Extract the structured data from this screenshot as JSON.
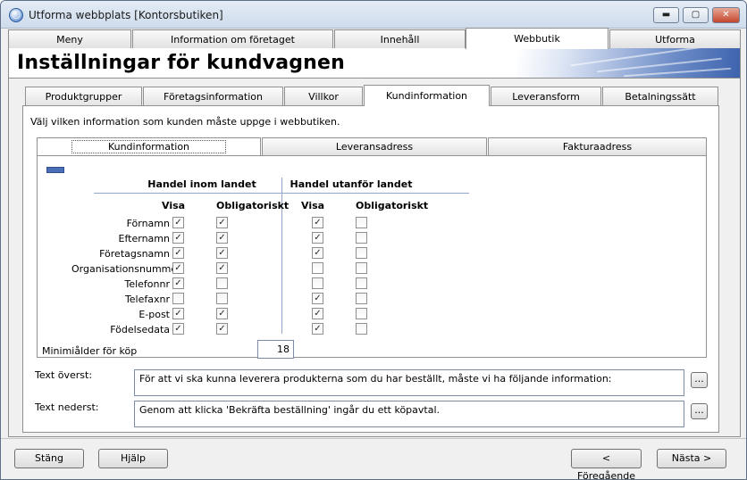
{
  "window": {
    "title": "Utforma webbplats [Kontorsbutiken]"
  },
  "main_tabs": [
    {
      "label": "Meny"
    },
    {
      "label": "Information om företaget"
    },
    {
      "label": "Innehåll"
    },
    {
      "label": "Webbutik"
    },
    {
      "label": "Utforma"
    }
  ],
  "main_tabs_active": "Webbutik",
  "page_title": "Inställningar för kundvagnen",
  "sub_tabs": [
    {
      "label": "Produktgrupper"
    },
    {
      "label": "Företagsinformation"
    },
    {
      "label": "Villkor"
    },
    {
      "label": "Kundinformation"
    },
    {
      "label": "Leveransform"
    },
    {
      "label": "Betalningssätt"
    }
  ],
  "sub_tabs_active": "Kundinformation",
  "description": "Välj vilken information som kunden måste uppge i webbutiken.",
  "inner_tabs": [
    {
      "label": "Kundinformation"
    },
    {
      "label": "Leveransadress"
    },
    {
      "label": "Fakturaadress"
    }
  ],
  "inner_tabs_active": "Kundinformation",
  "groups": {
    "domestic": "Handel inom landet",
    "abroad": "Handel utanför landet"
  },
  "columns": {
    "show": "Visa",
    "required": "Obligatoriskt"
  },
  "fields": [
    {
      "label": "Förnamn",
      "domestic_show": true,
      "domestic_required": true,
      "abroad_show": true,
      "abroad_required": false
    },
    {
      "label": "Efternamn",
      "domestic_show": true,
      "domestic_required": true,
      "abroad_show": true,
      "abroad_required": false
    },
    {
      "label": "Företagsnamn",
      "domestic_show": true,
      "domestic_required": true,
      "abroad_show": true,
      "abroad_required": false
    },
    {
      "label": "Organisationsnummer",
      "domestic_show": true,
      "domestic_required": true,
      "abroad_show": false,
      "abroad_required": false
    },
    {
      "label": "Telefonnr",
      "domestic_show": true,
      "domestic_required": false,
      "abroad_show": false,
      "abroad_required": false
    },
    {
      "label": "Telefaxnr",
      "domestic_show": false,
      "domestic_required": false,
      "abroad_show": true,
      "abroad_required": false
    },
    {
      "label": "E-post",
      "domestic_show": true,
      "domestic_required": true,
      "abroad_show": true,
      "abroad_required": false
    },
    {
      "label": "Födelsedata",
      "domestic_show": true,
      "domestic_required": true,
      "abroad_show": true,
      "abroad_required": false
    }
  ],
  "min_age": {
    "label": "Minimiålder för köp",
    "value": "18"
  },
  "text_top": {
    "label": "Text överst:",
    "value": "För att vi ska kunna leverera produkterna som du har beställt, måste vi ha följande information:"
  },
  "text_bottom": {
    "label": "Text nederst:",
    "value": "Genom att klicka 'Bekräfta beställning' ingår du ett köpavtal."
  },
  "ellipsis_label": "...",
  "buttons": {
    "close": "Stäng",
    "help": "Hjälp",
    "previous": "< Föregående",
    "next": "Nästa >"
  },
  "window_controls": {
    "minimize": "▬",
    "maximize": "▢",
    "close": "✕"
  },
  "colors": {
    "checked": "#2a2a2a",
    "divider": "#8fa7cc",
    "banner_accent": "#3d62ad"
  },
  "icons": {
    "app": "app-logo-icon",
    "check": "checkmark-icon"
  }
}
